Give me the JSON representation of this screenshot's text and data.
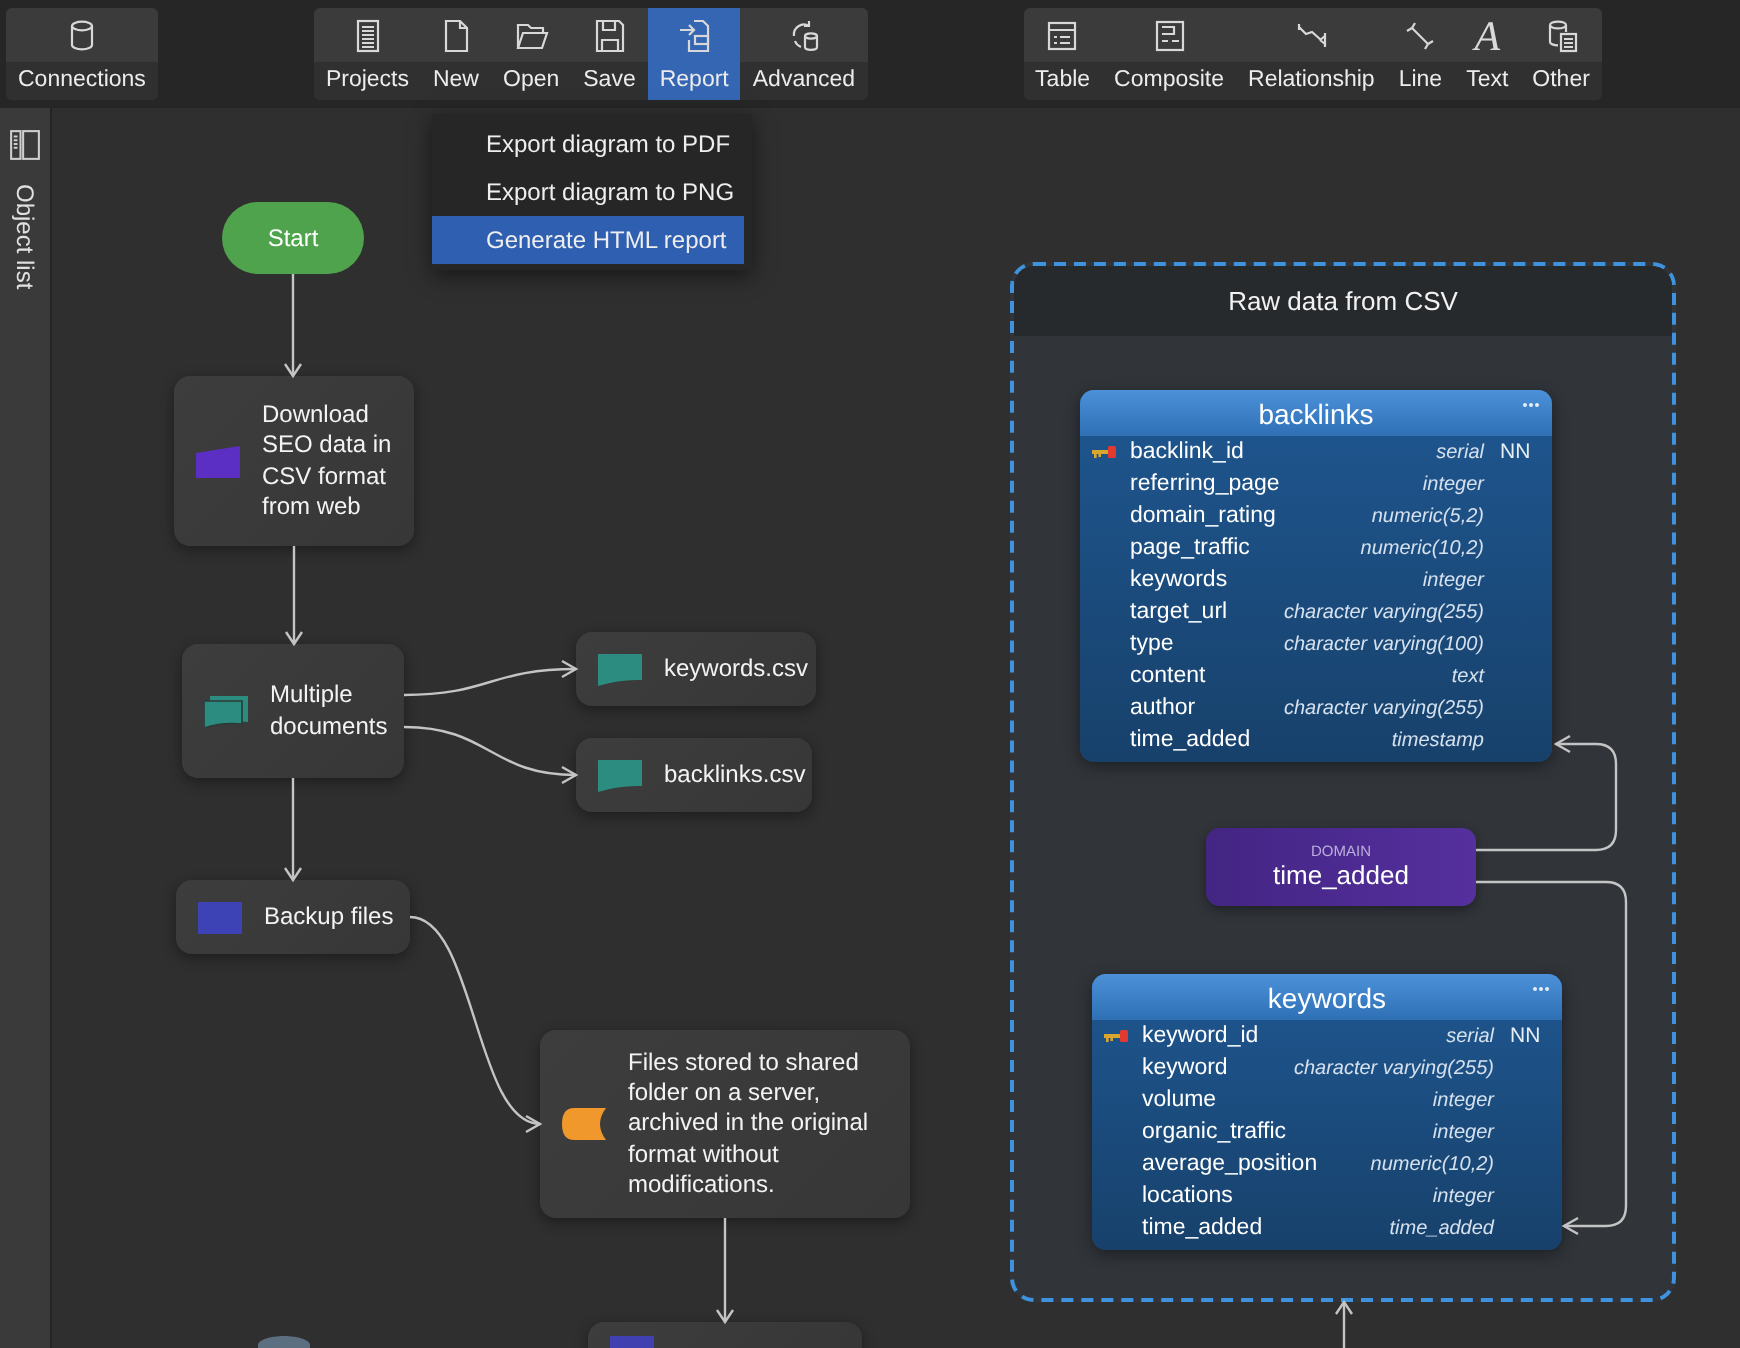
{
  "toolbar": {
    "groups": [
      {
        "buttons": [
          {
            "label": "Connections",
            "selected": false
          }
        ]
      },
      {
        "buttons": [
          {
            "label": "Projects",
            "selected": false
          },
          {
            "label": "New",
            "selected": false
          },
          {
            "label": "Open",
            "selected": false
          },
          {
            "label": "Save",
            "selected": false
          },
          {
            "label": "Report",
            "selected": true
          },
          {
            "label": "Advanced",
            "selected": false
          }
        ]
      },
      {
        "buttons": [
          {
            "label": "Table",
            "selected": false
          },
          {
            "label": "Composite",
            "selected": false
          },
          {
            "label": "Relationship",
            "selected": false
          },
          {
            "label": "Line",
            "selected": false
          },
          {
            "label": "Text",
            "selected": false,
            "glyph": "A"
          },
          {
            "label": "Other",
            "selected": false
          }
        ]
      }
    ]
  },
  "report_menu": {
    "items": [
      {
        "label": "Export diagram to PDF",
        "selected": false
      },
      {
        "label": "Export diagram to PNG",
        "selected": false
      },
      {
        "label": "Generate HTML report",
        "selected": true
      }
    ]
  },
  "sidebar": {
    "label": "Object list"
  },
  "flowchart": {
    "nodes": [
      {
        "kind": "terminal",
        "text": "Start",
        "color": "#4fa34d"
      },
      {
        "kind": "manual_input",
        "text": "Download SEO data in CSV format from web",
        "color": "#5b2fc4"
      },
      {
        "kind": "multi_document",
        "text": "Multiple documents",
        "color": "#2b8c7f"
      },
      {
        "kind": "document",
        "text": "keywords.csv",
        "color": "#2b8c7f"
      },
      {
        "kind": "document",
        "text": "backlinks.csv",
        "color": "#2b8c7f"
      },
      {
        "kind": "process",
        "text": "Backup files",
        "color": "#3d42b5"
      },
      {
        "kind": "stored_data",
        "text": "Files stored to shared folder on a server, archived in the original format without modifications.",
        "color": "#f0982c"
      },
      {
        "kind": "process",
        "color": "#4040b0"
      },
      {
        "kind": "database",
        "color": "#5b6f80"
      }
    ]
  },
  "group": {
    "title": "Raw data from CSV",
    "tables": [
      {
        "name": "backlinks",
        "columns": [
          {
            "name": "backlink_id",
            "type": "serial",
            "primary_key": true,
            "constraint": "NN"
          },
          {
            "name": "referring_page",
            "type": "integer",
            "primary_key": false
          },
          {
            "name": "domain_rating",
            "type": "numeric(5,2)",
            "primary_key": false
          },
          {
            "name": "page_traffic",
            "type": "numeric(10,2)",
            "primary_key": false
          },
          {
            "name": "keywords",
            "type": "integer",
            "primary_key": false
          },
          {
            "name": "target_url",
            "type": "character varying(255)",
            "primary_key": false
          },
          {
            "name": "type",
            "type": "character varying(100)",
            "primary_key": false
          },
          {
            "name": "content",
            "type": "text",
            "primary_key": false
          },
          {
            "name": "author",
            "type": "character varying(255)",
            "primary_key": false
          },
          {
            "name": "time_added",
            "type": "timestamp",
            "primary_key": false
          }
        ]
      },
      {
        "name": "keywords",
        "columns": [
          {
            "name": "keyword_id",
            "type": "serial",
            "primary_key": true,
            "constraint": "NN"
          },
          {
            "name": "keyword",
            "type": "character varying(255)",
            "primary_key": false
          },
          {
            "name": "volume",
            "type": "integer",
            "primary_key": false
          },
          {
            "name": "organic_traffic",
            "type": "integer",
            "primary_key": false
          },
          {
            "name": "average_position",
            "type": "numeric(10,2)",
            "primary_key": false
          },
          {
            "name": "locations",
            "type": "integer",
            "primary_key": false
          },
          {
            "name": "time_added",
            "type": "time_added",
            "primary_key": false
          }
        ]
      }
    ],
    "domain": {
      "kind_label": "DOMAIN",
      "name": "time_added"
    }
  }
}
